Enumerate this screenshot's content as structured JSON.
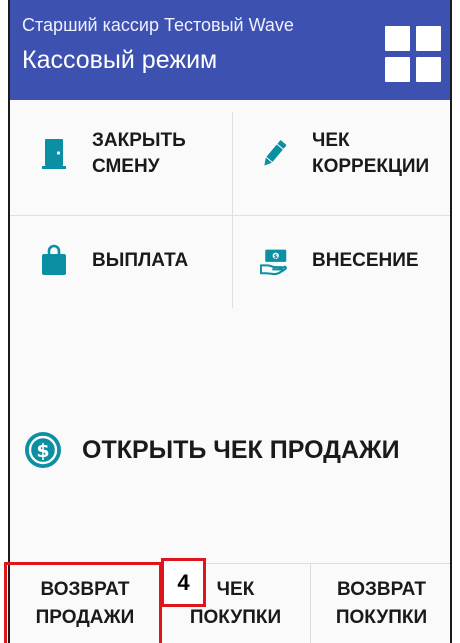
{
  "header": {
    "subtitle": "Старший кассир Тестовый Wave",
    "title": "Кассовый режим",
    "menu_icon": "grid-icon",
    "background_color": "#3d51b1"
  },
  "actions": [
    {
      "label": "ЗАКРЫТЬ\nСМЕНУ",
      "icon": "door-icon",
      "color": "#0b8fa3"
    },
    {
      "label": "ЧЕК\nКОРРЕКЦИИ",
      "icon": "pencil-icon",
      "color": "#0b8fa3"
    },
    {
      "label": "ВЫПЛАТА",
      "icon": "bag-icon",
      "color": "#0b8fa3"
    },
    {
      "label": "ВНЕСЕНИЕ",
      "icon": "cash-hand-icon",
      "color": "#0b8fa3"
    }
  ],
  "sale": {
    "label": "ОТКРЫТЬ ЧЕК ПРОДАЖИ",
    "icon": "dollar-circle-icon"
  },
  "bottom": {
    "return_sale": "ВОЗВРАТ\nПРОДАЖИ",
    "purchase_receipt": "ЧЕК\nПОКУПКИ",
    "return_purchase": "ВОЗВРАТ\nПОКУПКИ"
  },
  "annotation": {
    "step": "4",
    "highlight_color": "#e0151b"
  }
}
